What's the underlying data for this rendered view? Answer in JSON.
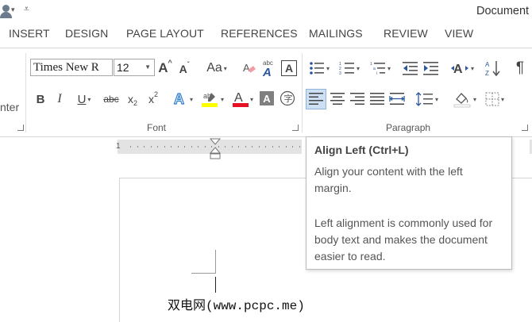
{
  "titlebar": {
    "doc_title": "Document"
  },
  "tabs": [
    "INSERT",
    "DESIGN",
    "PAGE LAYOUT",
    "REFERENCES",
    "MAILINGS",
    "REVIEW",
    "VIEW"
  ],
  "ribbon": {
    "clipboard_partial_label": "nter",
    "font_group": {
      "label": "Font",
      "font_name": "Times New R",
      "font_size": "12",
      "change_case_label": "Aa"
    },
    "paragraph_group": {
      "label": "Paragraph",
      "selected_button": "align-left"
    }
  },
  "ruler": {
    "start_number": "1"
  },
  "tooltip": {
    "title": "Align Left (Ctrl+L)",
    "description": "Align your content with the left margin.",
    "details": "Left alignment is commonly used for body text and makes the document easier to read."
  },
  "watermark": "双电网(www.pcpc.me)",
  "colors": {
    "accent": "#2b579a",
    "selected_bg": "#cde0f3",
    "highlight_yellow": "#ffff00",
    "font_color_red": "#e81123"
  },
  "icons": [
    "user-icon",
    "bullets-icon",
    "numbering-icon",
    "multilevel-list-icon",
    "decrease-indent-icon",
    "increase-indent-icon",
    "sort-icon",
    "pilcrow-icon",
    "shading-icon",
    "borders-icon",
    "line-spacing-icon",
    "clear-formatting-icon",
    "text-effects-icon"
  ]
}
